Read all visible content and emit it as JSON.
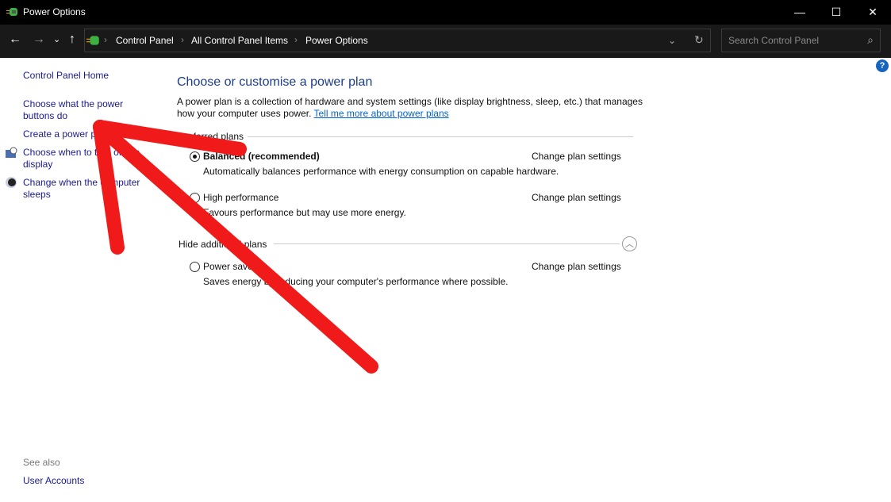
{
  "window": {
    "title": "Power Options",
    "minimize": "—",
    "maximize": "☐",
    "close": "✕"
  },
  "nav": {
    "back": "←",
    "forward": "→",
    "recent": "⌄",
    "up": "↑",
    "breadcrumb": [
      "Control Panel",
      "All Control Panel Items",
      "Power Options"
    ],
    "refresh": "↻",
    "dropdown": "⌄"
  },
  "search": {
    "placeholder": "Search Control Panel",
    "icon": "⌕"
  },
  "help": "?",
  "sidebar": {
    "home": "Control Panel Home",
    "items": [
      "Choose what the power buttons do",
      "Create a power plan",
      "Choose when to turn off the display",
      "Change when the computer sleeps"
    ],
    "see_also": "See also",
    "see_also_items": [
      "User Accounts"
    ]
  },
  "main": {
    "title": "Choose or customise a power plan",
    "intro": "A power plan is a collection of hardware and system settings (like display brightness, sleep, etc.) that manages how your computer uses power.",
    "intro_link": "Tell me more about power plans",
    "preferred_label": "Preferred plans",
    "additional_label": "Hide additional plans",
    "change_label": "Change plan settings",
    "plans": [
      {
        "name": "Balanced (recommended)",
        "desc": "Automatically balances performance with energy consumption on capable hardware.",
        "selected": true
      },
      {
        "name": "High performance",
        "desc": "Favours performance but may use more energy.",
        "selected": false
      },
      {
        "name": "Power saver",
        "desc": "Saves energy by reducing your computer's performance where possible.",
        "selected": false
      }
    ]
  },
  "annotation": {
    "color": "#f01a1a",
    "shape": "arrow"
  }
}
